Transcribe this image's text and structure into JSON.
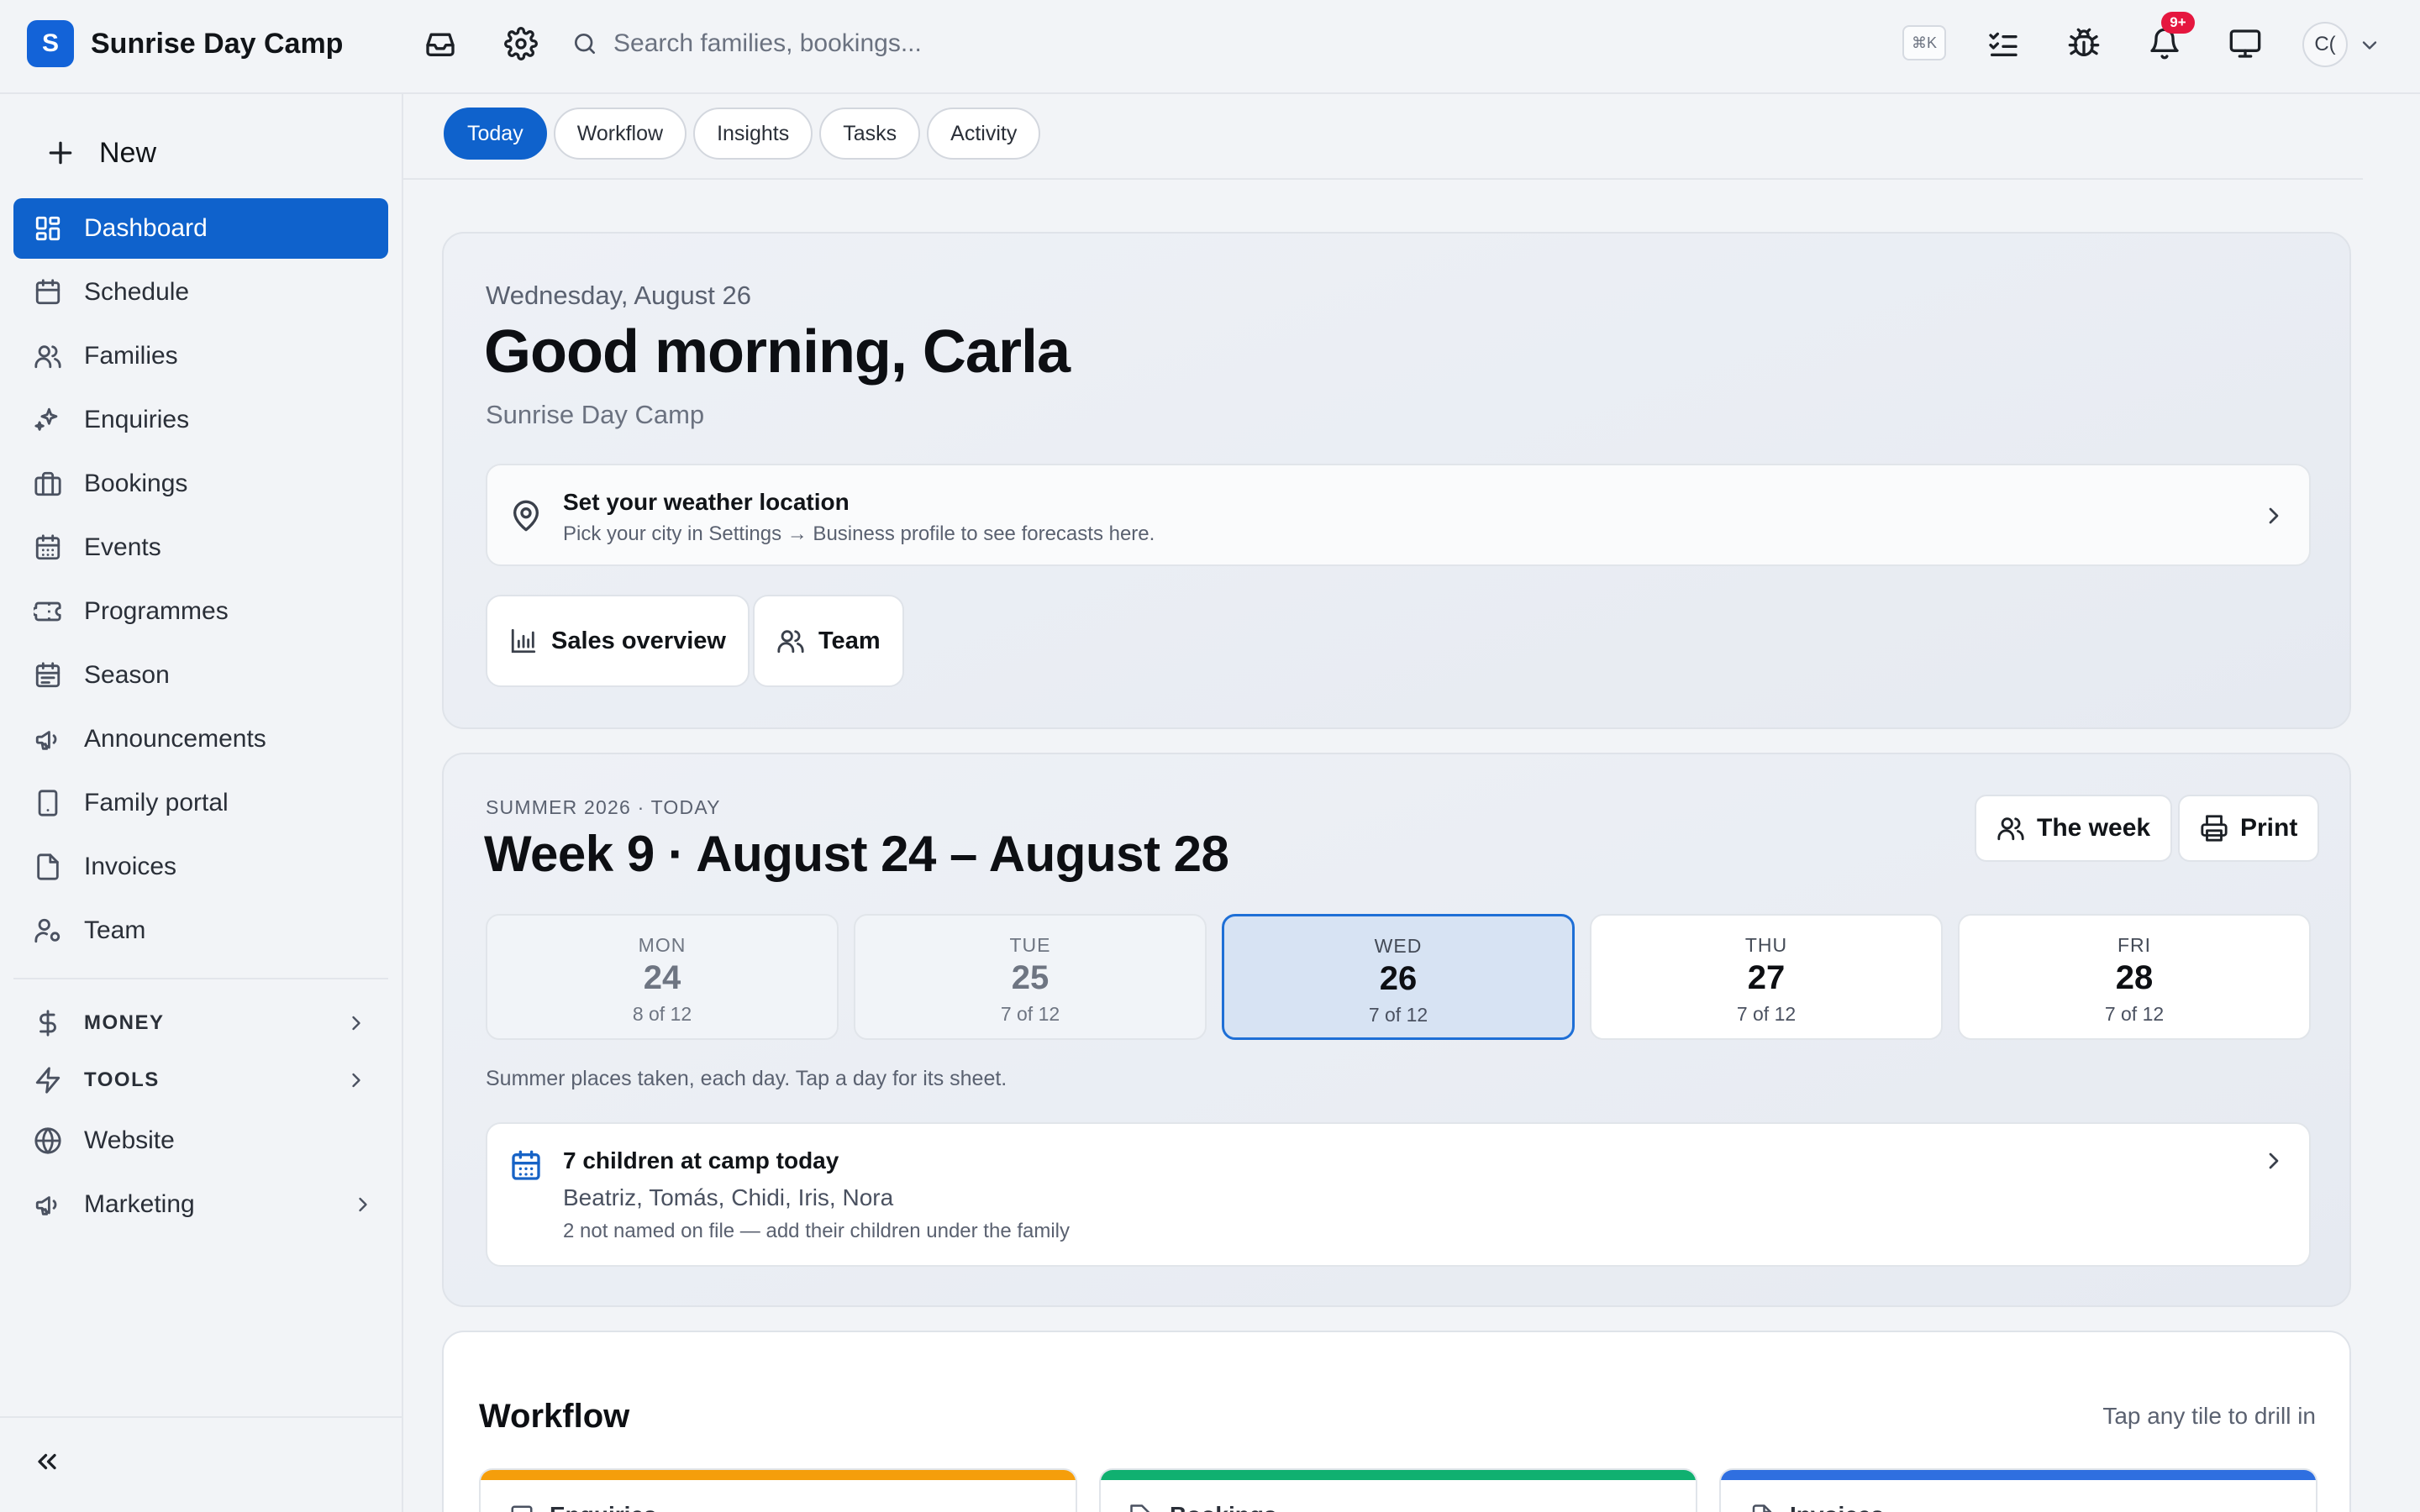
{
  "brand": {
    "logo_letter": "S",
    "name": "Sunrise Day Camp",
    "color": "#1363d8"
  },
  "search": {
    "placeholder": "Search families, bookings...",
    "value": ""
  },
  "topbar": {
    "shortcut": "⌘K",
    "icons": [
      "inbox-icon",
      "settings-icon",
      "tasks-icon",
      "bug-icon",
      "bell-icon",
      "display-icon"
    ],
    "notification_badge": "9+",
    "avatar_initials": "C("
  },
  "sidebar": {
    "new_label": "New",
    "items": [
      {
        "label": "Dashboard",
        "icon": "dashboard-icon",
        "active": true
      },
      {
        "label": "Schedule",
        "icon": "calendar-icon"
      },
      {
        "label": "Families",
        "icon": "users-icon"
      },
      {
        "label": "Enquiries",
        "icon": "sparkles-icon"
      },
      {
        "label": "Bookings",
        "icon": "briefcase-icon"
      },
      {
        "label": "Events",
        "icon": "calendar-grid-icon"
      },
      {
        "label": "Programmes",
        "icon": "ticket-icon"
      },
      {
        "label": "Season",
        "icon": "calendar-grid-icon"
      },
      {
        "label": "Announcements",
        "icon": "megaphone-icon"
      },
      {
        "label": "Family portal",
        "icon": "tablet-icon"
      },
      {
        "label": "Invoices",
        "icon": "file-icon"
      },
      {
        "label": "Team",
        "icon": "user-gear-icon"
      }
    ],
    "groups": [
      {
        "label": "MONEY",
        "icon": "dollar-icon"
      },
      {
        "label": "TOOLS",
        "icon": "bolt-icon"
      }
    ],
    "extras": [
      {
        "label": "Website",
        "icon": "globe-icon",
        "has_chevron": false
      },
      {
        "label": "Marketing",
        "icon": "megaphone-icon",
        "has_chevron": true
      }
    ]
  },
  "tabs": [
    {
      "label": "Today",
      "active": true
    },
    {
      "label": "Workflow"
    },
    {
      "label": "Insights"
    },
    {
      "label": "Tasks"
    },
    {
      "label": "Activity"
    }
  ],
  "hero": {
    "date": "Wednesday, August 26",
    "greeting": "Good morning, Carla",
    "business": "Sunrise Day Camp",
    "weather_title": "Set your weather location",
    "weather_hint": "Pick your city in Settings → Business profile to see forecasts here.",
    "buttons": [
      {
        "label": "Sales overview",
        "icon": "bar-chart-icon"
      },
      {
        "label": "Team",
        "icon": "users-icon"
      }
    ]
  },
  "week": {
    "season": "SUMMER 2026 · TODAY",
    "title": "Week 9 · August 24 – August 28",
    "the_week_label": "The week",
    "print_label": "Print",
    "days": [
      {
        "dow": "MON",
        "num": "24",
        "cap": "8 of 12",
        "state": "past"
      },
      {
        "dow": "TUE",
        "num": "25",
        "cap": "7 of 12",
        "state": "past"
      },
      {
        "dow": "WED",
        "num": "26",
        "cap": "7 of 12",
        "state": "today"
      },
      {
        "dow": "THU",
        "num": "27",
        "cap": "7 of 12",
        "state": "future"
      },
      {
        "dow": "FRI",
        "num": "28",
        "cap": "7 of 12",
        "state": "future"
      }
    ],
    "note": "Summer places taken, each day. Tap a day for its sheet.",
    "kids_title": "7 children at camp today",
    "kids_names": "Beatriz, Tomás, Chidi, Iris, Nora",
    "kids_note": "2 not named on file — add their children under the family"
  },
  "workflow": {
    "title": "Workflow",
    "hint": "Tap any tile to drill in",
    "tiles": [
      {
        "label": "Enquiries",
        "color": "#f59e0b"
      },
      {
        "label": "Bookings",
        "color": "#10b070"
      },
      {
        "label": "Invoices",
        "color": "#2f6fe0"
      }
    ]
  }
}
